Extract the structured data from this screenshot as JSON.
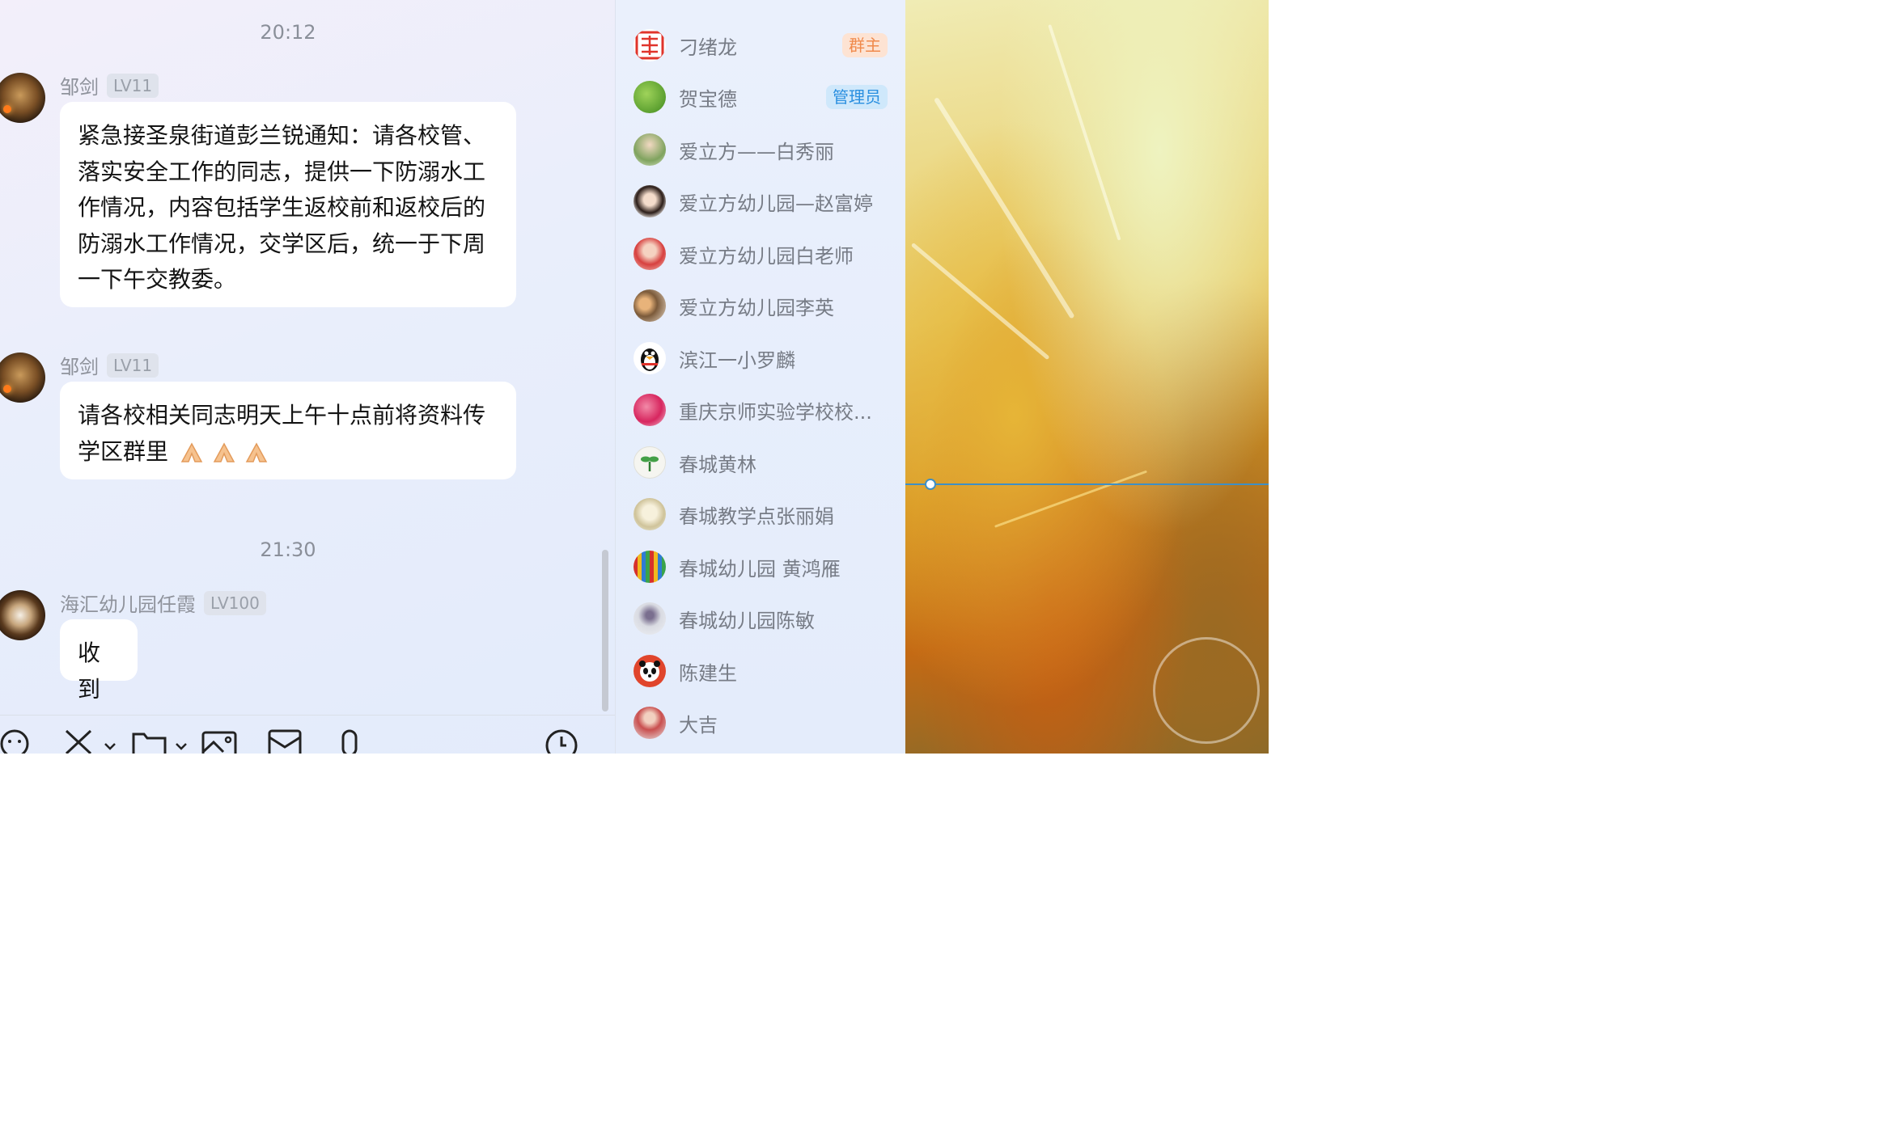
{
  "chat": {
    "timestamps": [
      "20:12",
      "21:30"
    ],
    "messages": [
      {
        "sender": "邹剑",
        "level": "LV11",
        "avatar": "penguin-avatar",
        "lines": [
          "紧急接圣泉街道彭兰锐通知：请各校管、",
          "落实安全工作的同志，提供一下防溺水工",
          "作情况，内容包括学生返校前和返校后的",
          "防溺水工作情况，交学区后，统一于下周",
          "一下午交教委。"
        ]
      },
      {
        "sender": "邹剑",
        "level": "LV11",
        "avatar": "penguin-avatar",
        "lines": [
          "请各校相关同志明天上午十点前将资料传",
          "学区群里"
        ]
      },
      {
        "sender": "海汇幼儿园任霞",
        "level": "LV100",
        "avatar": "coffee-avatar",
        "lines": [
          "收到"
        ]
      }
    ],
    "toolbar": [
      "emoji-icon",
      "scissors-icon",
      "folder-icon",
      "image-icon",
      "envelope-icon",
      "microphone-icon",
      "clock-icon"
    ]
  },
  "members": [
    {
      "name": "刁绪龙",
      "role": "群主",
      "avatar_color": "#e0342b"
    },
    {
      "name": "贺宝德",
      "role": "管理员",
      "avatar_color": "#58a82a"
    },
    {
      "name": "爱立方——白秀丽",
      "role": "",
      "avatar_color": "#a7c48a"
    },
    {
      "name": "爱立方幼儿园—赵富婷",
      "role": "",
      "avatar_color": "#3a2a25"
    },
    {
      "name": "爱立方幼儿园白老师",
      "role": "",
      "avatar_color": "#e25a5a"
    },
    {
      "name": "爱立方幼儿园李英",
      "role": "",
      "avatar_color": "#c9a36e"
    },
    {
      "name": "滨江一小罗麟",
      "role": "",
      "avatar_color": "#1a1a1a"
    },
    {
      "name": "重庆京师实验学校校...",
      "role": "",
      "avatar_color": "#e0306b"
    },
    {
      "name": "春城黄林",
      "role": "",
      "avatar_color": "#f3f3ee"
    },
    {
      "name": "春城教学点张丽娟",
      "role": "",
      "avatar_color": "#e8e3cf"
    },
    {
      "name": "春城幼儿园 黄鸿雁",
      "role": "",
      "avatar_color": "#d23a2a"
    },
    {
      "name": "春城幼儿园陈敏",
      "role": "",
      "avatar_color": "#cfd3dc"
    },
    {
      "name": "陈建生",
      "role": "",
      "avatar_color": "#e0452c"
    },
    {
      "name": "大吉",
      "role": "",
      "avatar_color": "#c94f4f"
    }
  ],
  "colors": {
    "owner_badge_bg": "#fde3d3",
    "owner_badge_text": "#f08a4c",
    "admin_badge_bg": "#cfe8fb",
    "admin_badge_text": "#2a8fe0"
  }
}
